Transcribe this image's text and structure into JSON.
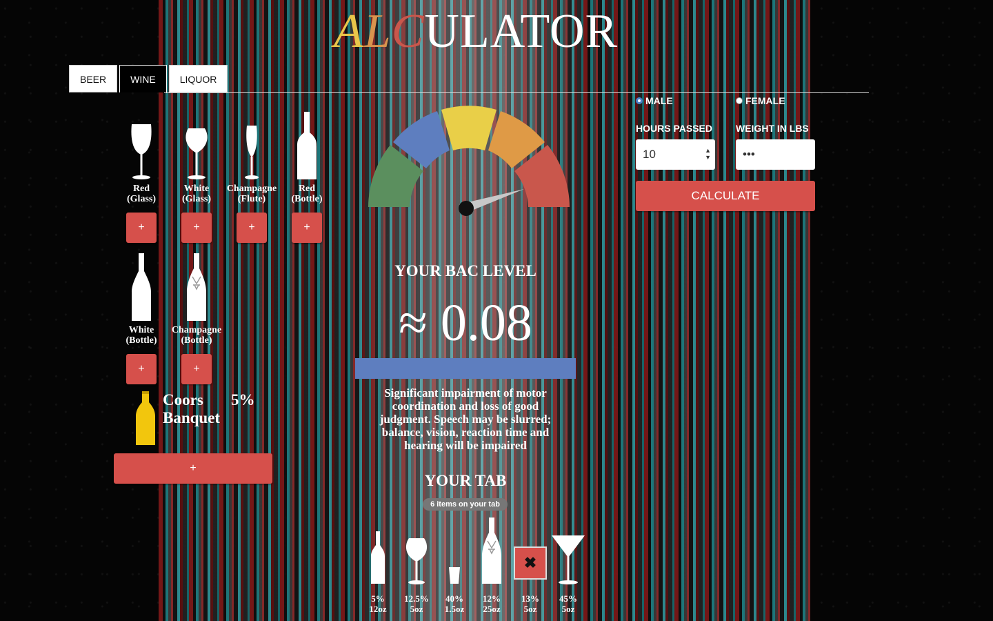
{
  "app": {
    "title_parts": [
      "A",
      "L",
      "C",
      "ULATOR"
    ],
    "colors": {
      "accent": "#d6504b",
      "gauge": [
        "#5b8f5e",
        "#5e7ebf",
        "#e9cf48",
        "#df9a46",
        "#c9574c"
      ],
      "bac_bar": "#5e7ebf"
    }
  },
  "tabs": [
    {
      "label": "BEER"
    },
    {
      "label": "WINE"
    },
    {
      "label": "LIQUOR"
    }
  ],
  "active_tab": "WINE",
  "drinks": [
    {
      "label_line1": "Red",
      "label_line2": "(Glass)",
      "icon": "wine-glass-icon",
      "add": "+"
    },
    {
      "label_line1": "White",
      "label_line2": "(Glass)",
      "icon": "white-wine-glass-icon",
      "add": "+"
    },
    {
      "label_line1": "Champagne",
      "label_line2": "(Flute)",
      "icon": "champagne-flute-icon",
      "add": "+"
    },
    {
      "label_line1": "Red",
      "label_line2": "(Bottle)",
      "icon": "wine-bottle-icon",
      "add": "+"
    },
    {
      "label_line1": "White",
      "label_line2": "(Bottle)",
      "icon": "white-wine-bottle-icon",
      "add": "+"
    },
    {
      "label_line1": "Champagne",
      "label_line2": "(Bottle)",
      "icon": "champagne-bottle-icon",
      "add": "+"
    }
  ],
  "custom_drink": {
    "name_line1": "Coors",
    "name_line2": "Banquet",
    "percent": "5%",
    "icon": "beer-bottle-icon",
    "add": "+"
  },
  "bac": {
    "heading": "YOUR BAC LEVEL",
    "value": "≈ 0.08",
    "description": "Significant impairment of motor coordination and loss of good judgment. Speech may be slurred; balance, vision, reaction time and hearing will be impaired"
  },
  "your_tab": {
    "heading": "YOUR TAB",
    "badge": "6 items on your tab",
    "items": [
      {
        "abv": "5%",
        "size": "12oz",
        "icon": "beer-bottle-icon"
      },
      {
        "abv": "12.5%",
        "size": "5oz",
        "icon": "white-wine-glass-icon"
      },
      {
        "abv": "40%",
        "size": "1.5oz",
        "icon": "shot-glass-icon"
      },
      {
        "abv": "12%",
        "size": "25oz",
        "icon": "champagne-bottle-icon"
      },
      {
        "abv": "13%",
        "size": "5oz",
        "icon": "remove-icon"
      },
      {
        "abv": "45%",
        "size": "5oz",
        "icon": "martini-glass-icon"
      }
    ],
    "remove_symbol": "✖"
  },
  "form": {
    "male_label": "MALE",
    "female_label": "FEMALE",
    "selected_gender": "MALE",
    "hours_label": "HOURS PASSED",
    "hours_value": "10",
    "weight_label": "WEIGHT IN LBS",
    "weight_value": "•••",
    "calculate_label": "CALCULATE"
  }
}
